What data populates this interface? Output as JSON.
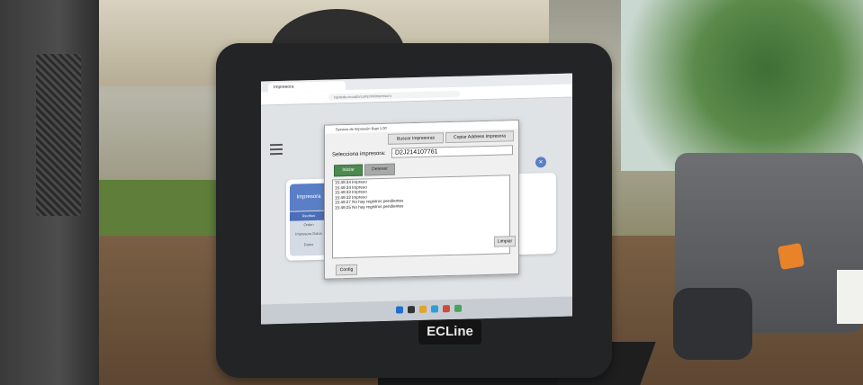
{
  "browser": {
    "tab_label": "Impresora",
    "url": "rapitcdo.ecuadorcomp/mi/impresora"
  },
  "app": {
    "side_title": "Impresora",
    "side_items": [
      "Recibos",
      "Orden",
      "Impresora Datos",
      "Datos"
    ]
  },
  "dialog": {
    "title": "Servicio de Impresión Rapi 1.00",
    "buscar_label": "Buscar Impresoras",
    "copiar_label": "Copiar Address Impresora",
    "select_label": "Selecciona impresora:",
    "selected_printer": "D2J214107761",
    "iniciar_label": "Iniciar",
    "detener_label": "Detener",
    "log": [
      "15:49:34  Impreso",
      "15:49:34  Impreso",
      "15:49:33  Impreso",
      "15:49:32  Impreso",
      "15:49:27  No hay registros pendientes",
      "15:49:25  No hay registros pendientes"
    ],
    "config_label": "Config",
    "limpiar_label": "Limpiar"
  },
  "monitor": {
    "brand": "ECLine"
  },
  "colors": {
    "accent": "#5a7fc7",
    "start_green": "#4e8a50",
    "printer_button": "#e8832a"
  }
}
